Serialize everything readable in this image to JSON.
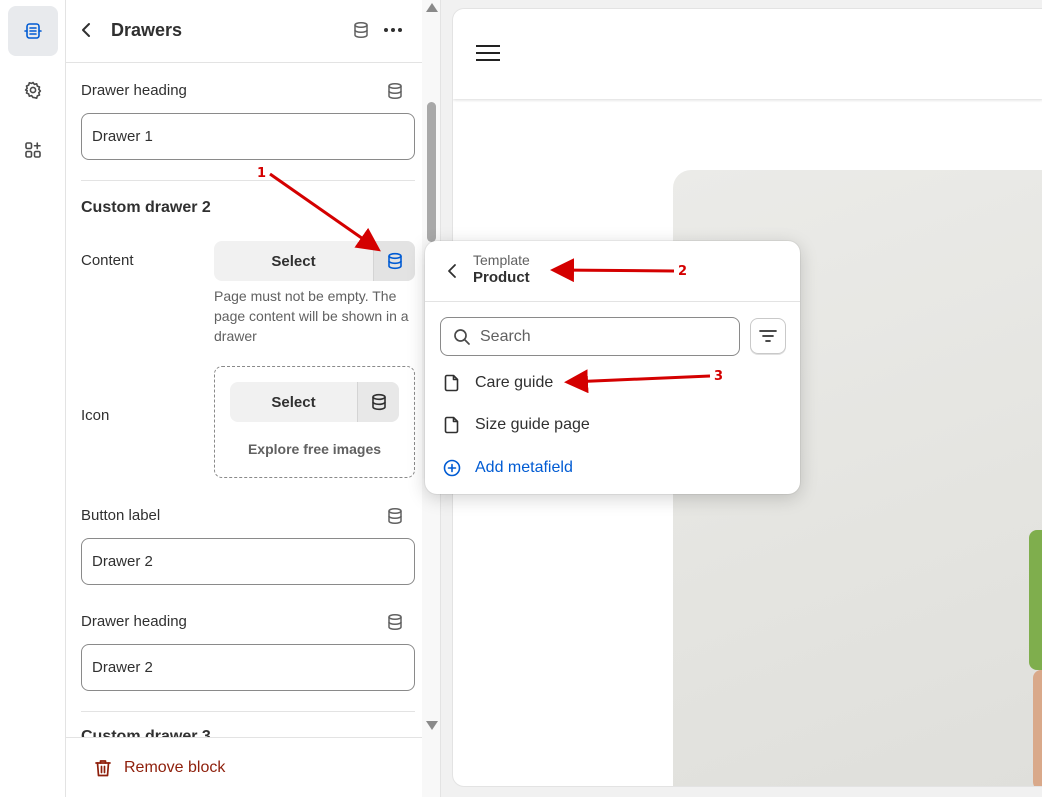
{
  "rail": {
    "items": [
      {
        "icon": "sections-icon",
        "active": true
      },
      {
        "icon": "gear-icon",
        "active": false
      },
      {
        "icon": "apps-icon",
        "active": false
      }
    ]
  },
  "panel": {
    "title": "Drawers",
    "drawer_heading_1": {
      "label": "Drawer heading",
      "value": "Drawer 1"
    },
    "section_title": "Custom drawer 2",
    "content": {
      "label": "Content",
      "select_label": "Select",
      "help": "Page must not be empty. The page content will be shown in a drawer"
    },
    "icon": {
      "label": "Icon",
      "select_label": "Select",
      "explore_label": "Explore free images"
    },
    "button_label": {
      "label": "Button label",
      "value": "Drawer 2"
    },
    "drawer_heading_2": {
      "label": "Drawer heading",
      "value": "Drawer 2"
    },
    "next_section_title": "Custom drawer 3",
    "remove_label": "Remove block"
  },
  "popover": {
    "breadcrumb": "Template",
    "title": "Product",
    "search_placeholder": "Search",
    "items": [
      {
        "label": "Care guide",
        "icon": "page-icon"
      },
      {
        "label": "Size guide page",
        "icon": "page-icon"
      }
    ],
    "add_label": "Add metafield"
  },
  "annotations": {
    "labels": [
      "1",
      "2",
      "3"
    ],
    "color": "#d40000"
  },
  "colors": {
    "accent_blue": "#005bd3",
    "critical": "#8e1f0b",
    "sweater_green": "#7fae4d"
  }
}
